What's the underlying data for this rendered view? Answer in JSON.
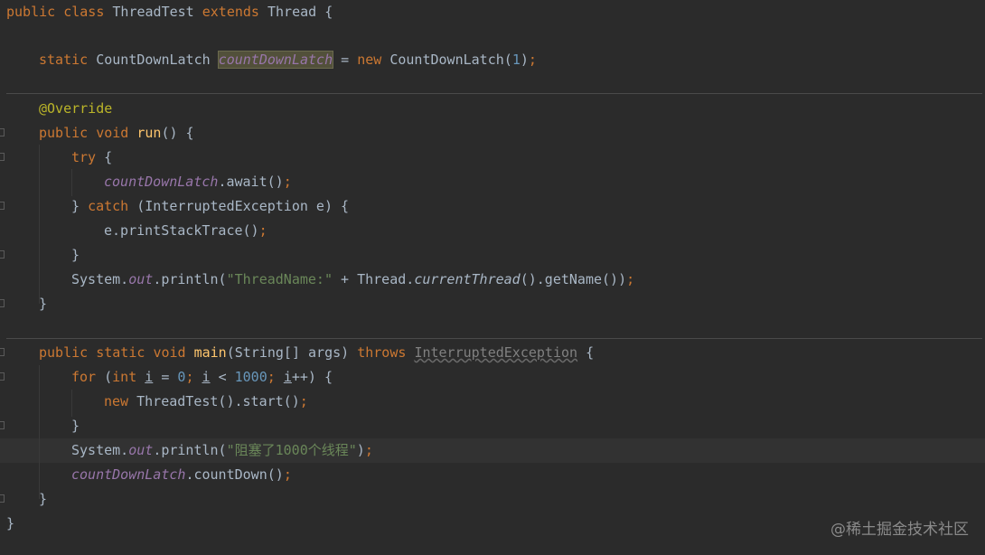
{
  "code": {
    "l1": {
      "t1": "public",
      "t2": "class",
      "t3": "ThreadTest",
      "t4": "extends",
      "t5": "Thread",
      "t6": "{"
    },
    "l2": {
      "t1": "static",
      "t2": "CountDownLatch",
      "t3": "countDownLatch",
      "t4": "=",
      "t5": "new",
      "t6": "CountDownLatch(",
      "t7": "1",
      "t8": ")",
      "t9": ";"
    },
    "l3": {
      "t1": "@Override"
    },
    "l4": {
      "t1": "public",
      "t2": "void",
      "t3": "run",
      "t4": "() {"
    },
    "l5": {
      "t1": "try",
      "t2": "{"
    },
    "l6": {
      "t1": "countDownLatch",
      "t2": ".await()",
      "t3": ";"
    },
    "l7": {
      "t1": "}",
      "t2": "catch",
      "t3": "(InterruptedException e) {"
    },
    "l8": {
      "t1": "e.printStackTrace()",
      "t2": ";"
    },
    "l9": {
      "t1": "}"
    },
    "l10": {
      "t1": "System.",
      "t2": "out",
      "t3": ".println(",
      "t4": "\"ThreadName:\"",
      "t5": " + Thread.",
      "t6": "currentThread",
      "t7": "().getName())",
      "t8": ";"
    },
    "l11": {
      "t1": "}"
    },
    "l12": {
      "t1": "public",
      "t2": "static",
      "t3": "void",
      "t4": "main",
      "t5": "(String[] args)",
      "t6": "throws",
      "t7": "InterruptedException",
      "t8": "{"
    },
    "l13": {
      "t1": "for",
      "t2": "(",
      "t3": "int",
      "t4": "i",
      "t5": "=",
      "t6": "0",
      "t7": ";",
      "t8": "i",
      "t9": "<",
      "t10": "1000",
      "t11": ";",
      "t12": "i",
      "t13": "++) {"
    },
    "l14": {
      "t1": "new",
      "t2": "ThreadTest().start()",
      "t3": ";"
    },
    "l15": {
      "t1": "}"
    },
    "l16": {
      "t1": "System.",
      "t2": "out",
      "t3": ".println(",
      "t4": "\"阻塞了1000个线程\"",
      "t5": ")",
      "t6": ";"
    },
    "l17": {
      "t1": "countDownLatch",
      "t2": ".countDown()",
      "t3": ";"
    },
    "l18": {
      "t1": "}"
    },
    "l19": {
      "t1": "}"
    }
  },
  "watermark": "@稀土掘金技术社区"
}
